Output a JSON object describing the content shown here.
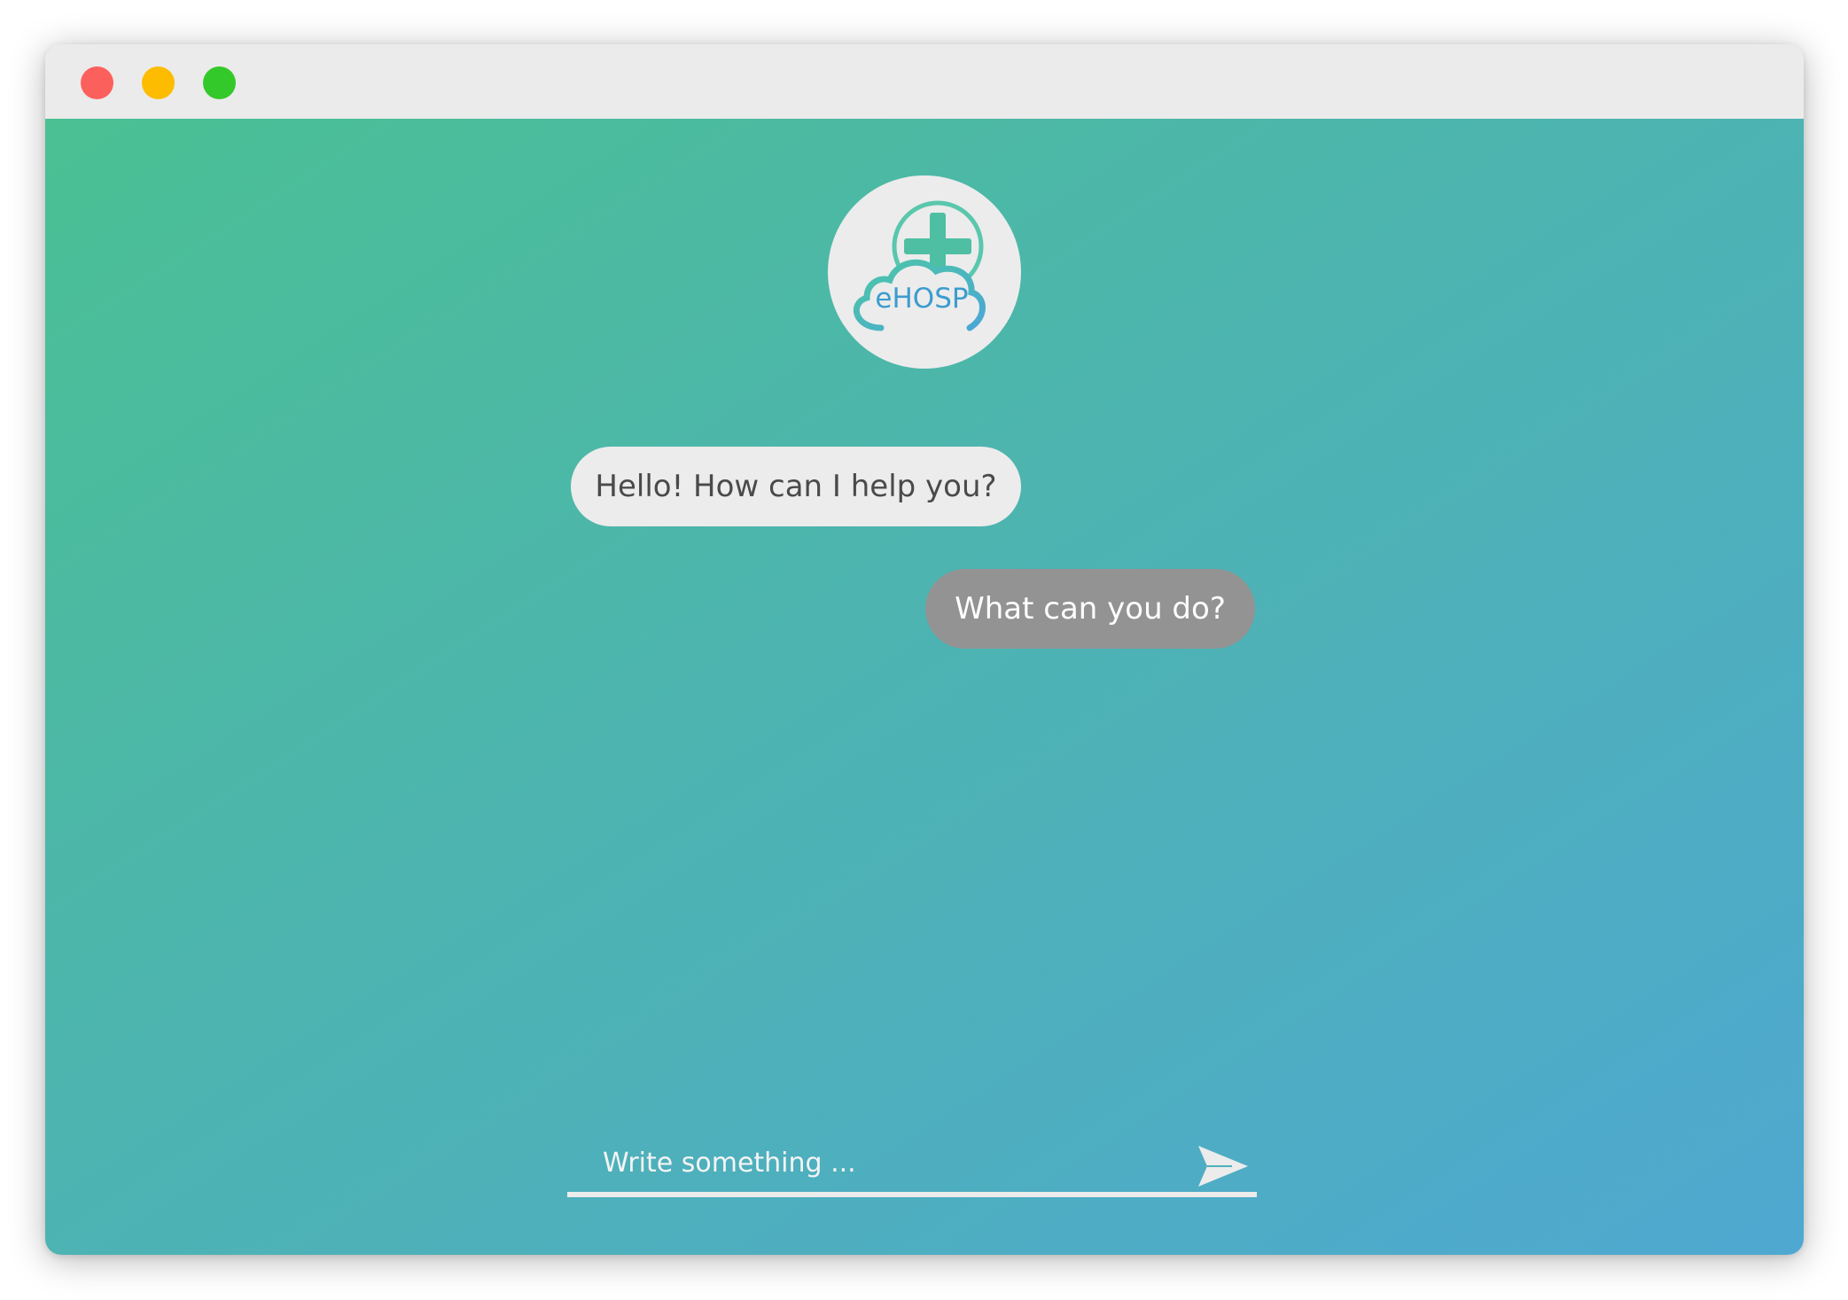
{
  "window": {
    "controls": [
      {
        "name": "close",
        "color": "#fc605c"
      },
      {
        "name": "minimize",
        "color": "#fdbc00"
      },
      {
        "name": "maximize",
        "color": "#34c92b"
      }
    ]
  },
  "theme": {
    "gradient_start": "#4ac093",
    "gradient_end": "#4fa8d1",
    "bot_bubble_color": "#ececec",
    "user_bubble_color": "#939393"
  },
  "logo": {
    "text": "eHOSP",
    "icon": "medical-cross-cloud-icon"
  },
  "messages": [
    {
      "sender": "bot",
      "text": "Hello! How can I help you?"
    },
    {
      "sender": "user",
      "text": "What can you do?"
    }
  ],
  "composer": {
    "placeholder": "Write something ...",
    "value": "",
    "send_icon": "paper-plane-icon"
  }
}
